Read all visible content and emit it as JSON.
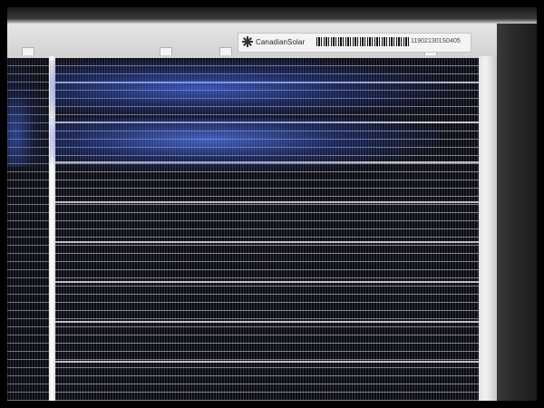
{
  "photo": {
    "subject_icon": "solar-panel-photo"
  },
  "label": {
    "brand": "CanadianSolar",
    "serial": "119021301S0405",
    "brand_mark_icon": "canadian-solar-logo-icon",
    "barcode_icon": "barcode-icon"
  },
  "colors": {
    "cell": "#0a0b12",
    "reflection": "#5078ff",
    "frame": "#d4d4d4",
    "border": "#000000"
  }
}
